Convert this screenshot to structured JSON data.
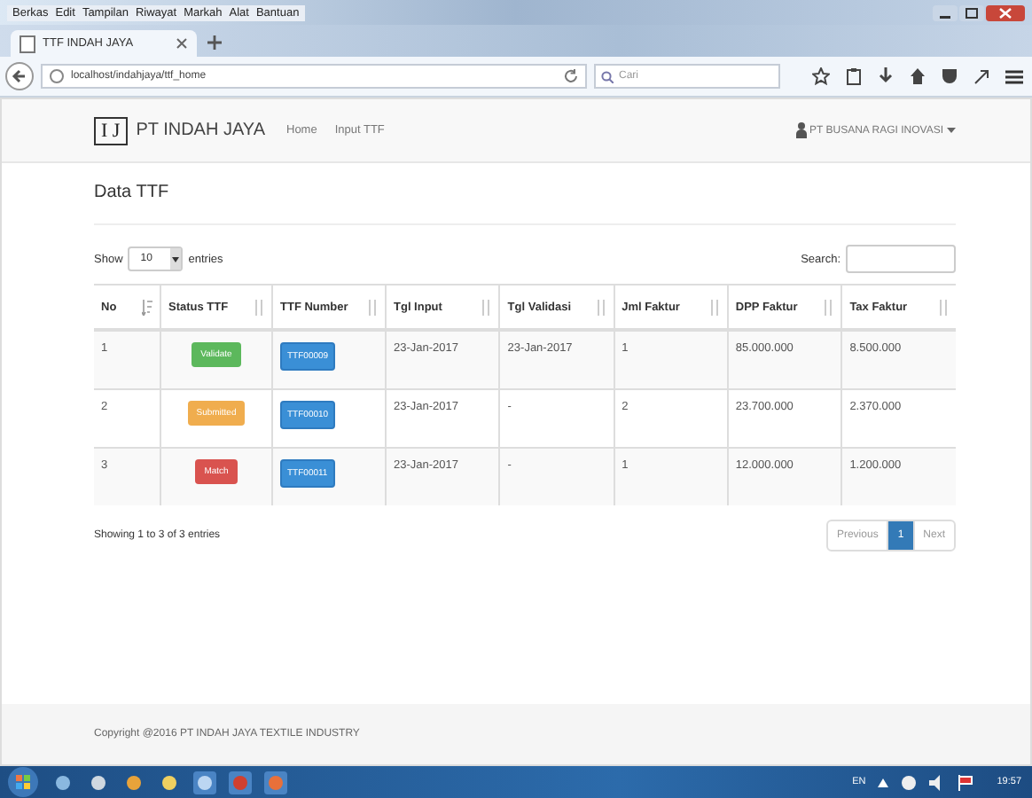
{
  "browser": {
    "menu": [
      "Berkas",
      "Edit",
      "Tampilan",
      "Riwayat",
      "Markah",
      "Alat",
      "Bantuan"
    ],
    "tabs": [
      {
        "label": "TTF INDAH JAYA",
        "selected": true
      }
    ],
    "address": "localhost/indahjaya/ttf_home",
    "search": {
      "placeholder": "Cari"
    }
  },
  "navbar": {
    "brand_mark": "I J",
    "brand": "PT INDAH JAYA",
    "links": [
      "Home",
      "Input TTF"
    ],
    "user": "PT BUSANA RAGI INOVASI"
  },
  "page_title": "Data TTF",
  "length": {
    "before": "Show",
    "value": "10",
    "after": "entries"
  },
  "search": {
    "label": "Search:"
  },
  "table": {
    "columns": [
      "No",
      "Status TTF",
      "TTF Number",
      "Tgl Input",
      "Tgl Validasi",
      "Jml Faktur",
      "DPP Faktur",
      "Tax Faktur"
    ],
    "rows": [
      {
        "no": "1",
        "status": {
          "label": "Validate",
          "color": "#5cb85c"
        },
        "ttf": "TTF00009",
        "tgl_input": "23-Jan-2017",
        "tgl_validasi": "23-Jan-2017",
        "jml": "1",
        "dpp": "85.000.000",
        "tax": "8.500.000"
      },
      {
        "no": "2",
        "status": {
          "label": "Submitted",
          "color": "#f0ad4e"
        },
        "ttf": "TTF00010",
        "tgl_input": "23-Jan-2017",
        "tgl_validasi": "-",
        "jml": "2",
        "dpp": "23.700.000",
        "tax": "2.370.000"
      },
      {
        "no": "3",
        "status": {
          "label": "Match",
          "color": "#d9534f"
        },
        "ttf": "TTF00011",
        "tgl_input": "23-Jan-2017",
        "tgl_validasi": "-",
        "jml": "1",
        "dpp": "12.000.000",
        "tax": "1.200.000"
      }
    ]
  },
  "info": "Showing 1 to 3 of 3 entries",
  "pagination": [
    {
      "label": "Previous",
      "selected": false
    },
    {
      "label": "1",
      "selected": true
    },
    {
      "label": "Next",
      "selected": false
    }
  ],
  "footer": "Copyright @2016 PT INDAH JAYA TEXTILE INDUSTRY",
  "taskbar": {
    "language": "EN",
    "clock": "19:57"
  }
}
